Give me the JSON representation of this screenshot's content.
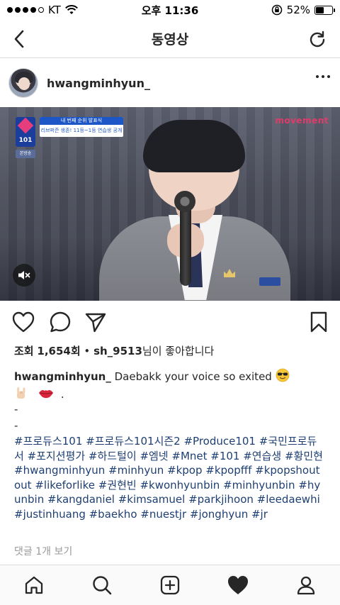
{
  "status_bar": {
    "carrier": "KT",
    "time": "오후 11:36",
    "battery_percent": "52%",
    "battery_level": 0.52
  },
  "nav": {
    "title": "동영상",
    "back_icon": "chevron-left-icon",
    "refresh_icon": "refresh-icon"
  },
  "post": {
    "username": "hwangminhyun_"
  },
  "video": {
    "overlay_brand": "movement",
    "banner_top": "내 번째 순위 발표식",
    "banner_bottom": "리브퍼즌 생존! 11등~1등 연습생 공개",
    "logo_text": "101",
    "small_tag": "본방송"
  },
  "likes": {
    "views_label": "조회",
    "views_count": "1,654회",
    "separator": "•",
    "liker": "sh_9513",
    "suffix": "님이 좋아합니다"
  },
  "caption": {
    "username": "hwangminhyun_",
    "text": "Daebakk your voice so exited",
    "emoji_line_end": ".",
    "dash1": "-",
    "dash2": "-",
    "hashtags": "#프로듀스101 #프로듀스101시즌2  #Produce101 #국민프로듀서 #포지션평가 #하드털이 #엠넷 #Mnet #101 #연습생 #황민현 #hwangminhyun #minhyun #kpop #kpopfff #kpopshoutout #likeforlike #권현빈 #kwonhyunbin #minhyunbin #hyunbin #kangdaniel #kimsamuel #parkjihoon #leedaewhi #justinhuang #baekho #nuestjr #jonghyun #jr"
  },
  "comments": {
    "view_label": "댓글 1개 보기"
  },
  "colors": {
    "hashtag": "#1e3f73",
    "muted": "#999999",
    "text": "#262626",
    "brand_overlay": "#e03b6a"
  }
}
